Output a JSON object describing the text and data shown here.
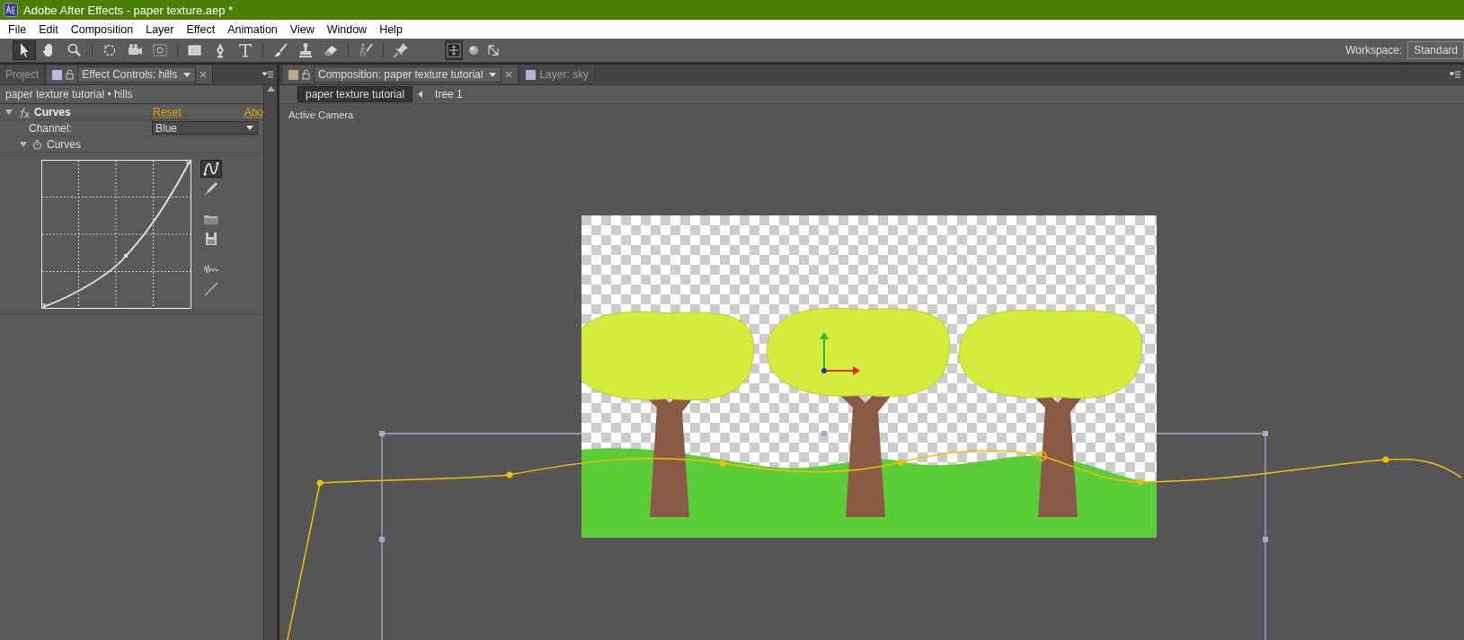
{
  "window": {
    "title": "Adobe After Effects - paper texture.aep *"
  },
  "menu": [
    "File",
    "Edit",
    "Composition",
    "Layer",
    "Effect",
    "Animation",
    "View",
    "Window",
    "Help"
  ],
  "toolbar": {
    "tools": [
      {
        "kind": "arrow",
        "selected": true
      },
      {
        "kind": "hand",
        "selected": false
      },
      {
        "kind": "zoom",
        "selected": false
      },
      {
        "kind": "rotate",
        "selected": false
      },
      {
        "kind": "camera",
        "selected": false
      },
      {
        "kind": "pan",
        "selected": false
      },
      {
        "kind": "rectangle",
        "selected": false
      },
      {
        "kind": "pen",
        "selected": false
      },
      {
        "kind": "type",
        "selected": false
      },
      {
        "kind": "brush",
        "selected": false
      },
      {
        "kind": "stamp",
        "selected": false
      },
      {
        "kind": "eraser",
        "selected": false
      },
      {
        "kind": "roto",
        "selected": false
      },
      {
        "kind": "pin",
        "selected": false
      }
    ],
    "axes": [
      {
        "kind": "local",
        "selected": true
      },
      {
        "kind": "world",
        "selected": false
      },
      {
        "kind": "view",
        "selected": false
      }
    ],
    "workspace_label": "Workspace:",
    "workspace": "Standard"
  },
  "left_panel": {
    "tabs": [
      {
        "label": "Project",
        "selected": false
      },
      {
        "label": "Effect Controls: hills",
        "selected": true
      }
    ],
    "breadcrumb": "paper texture tutorial • hills",
    "effect": {
      "name": "Curves",
      "expanded": true,
      "reset": "Reset",
      "about": "Abo",
      "channel_label": "Channel:",
      "channel": "Blue",
      "curves_label": "Curves",
      "curves_expanded": true
    },
    "curve_tools": [
      {
        "kind": "bezier",
        "selected": true
      },
      {
        "kind": "pencil",
        "selected": false
      },
      {
        "kind": "open",
        "selected": false
      },
      {
        "kind": "save",
        "selected": false
      },
      {
        "kind": "smooth",
        "selected": false
      },
      {
        "kind": "reset",
        "selected": false
      }
    ]
  },
  "comp_panel": {
    "tabs": [
      {
        "label": "Composition: paper texture tutorial",
        "selected": true
      },
      {
        "label": "Layer: sky",
        "selected": false
      }
    ],
    "flow": [
      {
        "label": "paper texture tutorial",
        "selected": true
      },
      {
        "label": "tree 1",
        "selected": false
      }
    ],
    "view_label": "Active Camera"
  }
}
